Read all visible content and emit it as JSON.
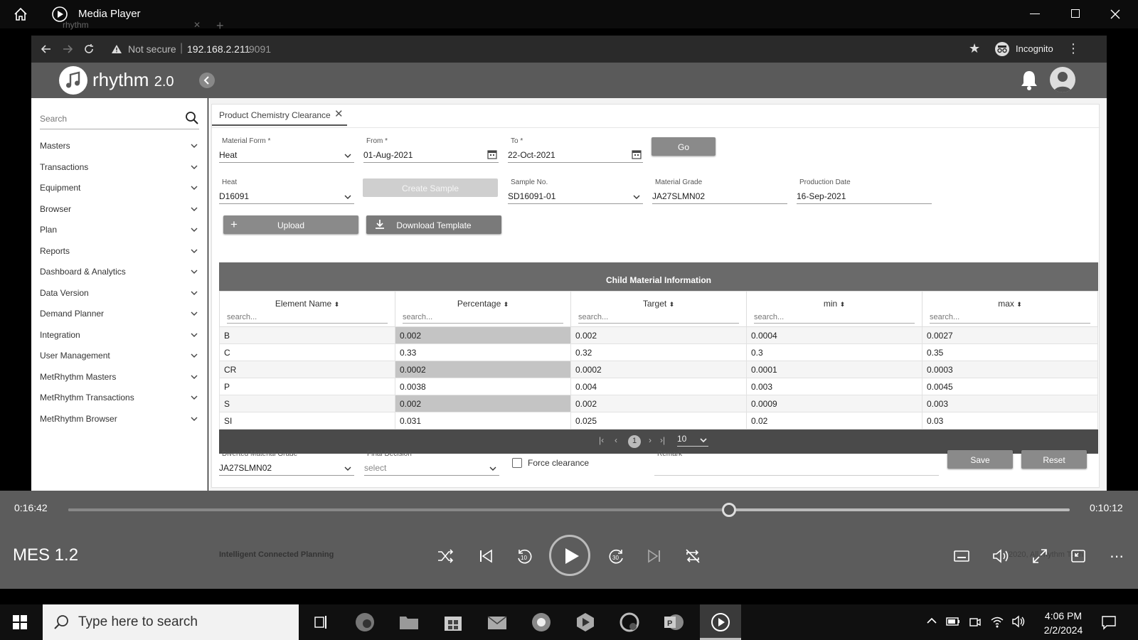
{
  "media_player": {
    "title": "Media Player",
    "elapsed": "0:16:42",
    "remaining": "0:10:12",
    "progress_fraction": 0.66,
    "video_title": "MES 1.2"
  },
  "browser": {
    "tab_title": "rhythm",
    "security_label": "Not secure",
    "url_host": "192.168.2.211",
    "url_port": ":9091",
    "incognito_label": "Incognito"
  },
  "app": {
    "logo_text": "rhythm",
    "logo_version": "2.0",
    "footer_text": "Intelligent Connected Planning",
    "copyright": "2020, All rhythm Tech."
  },
  "sidebar": {
    "search_placeholder": "Search",
    "items": [
      "Masters",
      "Transactions",
      "Equipment",
      "Browser",
      "Plan",
      "Reports",
      "Dashboard & Analytics",
      "Data Version",
      "Demand Planner",
      "Integration",
      "User Management",
      "MetRhythm Masters",
      "MetRhythm Transactions",
      "MetRhythm Browser"
    ]
  },
  "page_tab": {
    "label": "Product Chemistry Clearance"
  },
  "form": {
    "material_form_label": "Material Form *",
    "material_form_value": "Heat",
    "from_label": "From *",
    "from_value": "01-Aug-2021",
    "to_label": "To *",
    "to_value": "22-Oct-2021",
    "go_label": "Go",
    "heat_label": "Heat",
    "heat_value": "D16091",
    "create_sample_label": "Create Sample",
    "sample_no_label": "Sample No.",
    "sample_no_value": "SD16091-01",
    "material_grade_label": "Material Grade",
    "material_grade_value": "JA27SLMN02",
    "production_date_label": "Production Date",
    "production_date_value": "16-Sep-2021",
    "upload_label": "Upload",
    "download_template_label": "Download Template"
  },
  "grid": {
    "caption": "Child Material Information",
    "search_placeholder": "search...",
    "columns": [
      "Element Name",
      "Percentage",
      "Target",
      "min",
      "max"
    ],
    "rows": [
      [
        "B",
        "0.002",
        "0.002",
        "0.0004",
        "0.0027"
      ],
      [
        "C",
        "0.33",
        "0.32",
        "0.3",
        "0.35"
      ],
      [
        "CR",
        "0.0002",
        "0.0002",
        "0.0001",
        "0.0003"
      ],
      [
        "P",
        "0.0038",
        "0.004",
        "0.003",
        "0.0045"
      ],
      [
        "S",
        "0.002",
        "0.002",
        "0.0009",
        "0.003"
      ],
      [
        "SI",
        "0.031",
        "0.025",
        "0.02",
        "0.03"
      ]
    ],
    "pager": {
      "current_page": "1",
      "page_size": "10"
    }
  },
  "footer_form": {
    "diverted_grade_label": "Diverted Material Grade",
    "diverted_grade_value": "JA27SLMN02",
    "final_decision_label": "Final Decision",
    "final_decision_value": "select",
    "force_clearance_label": "Force clearance",
    "remark_label": "Remark",
    "save_label": "Save",
    "reset_label": "Reset"
  },
  "taskbar": {
    "search_placeholder": "Type here to search",
    "time": "4:06 PM",
    "date": "2/2/2024"
  }
}
